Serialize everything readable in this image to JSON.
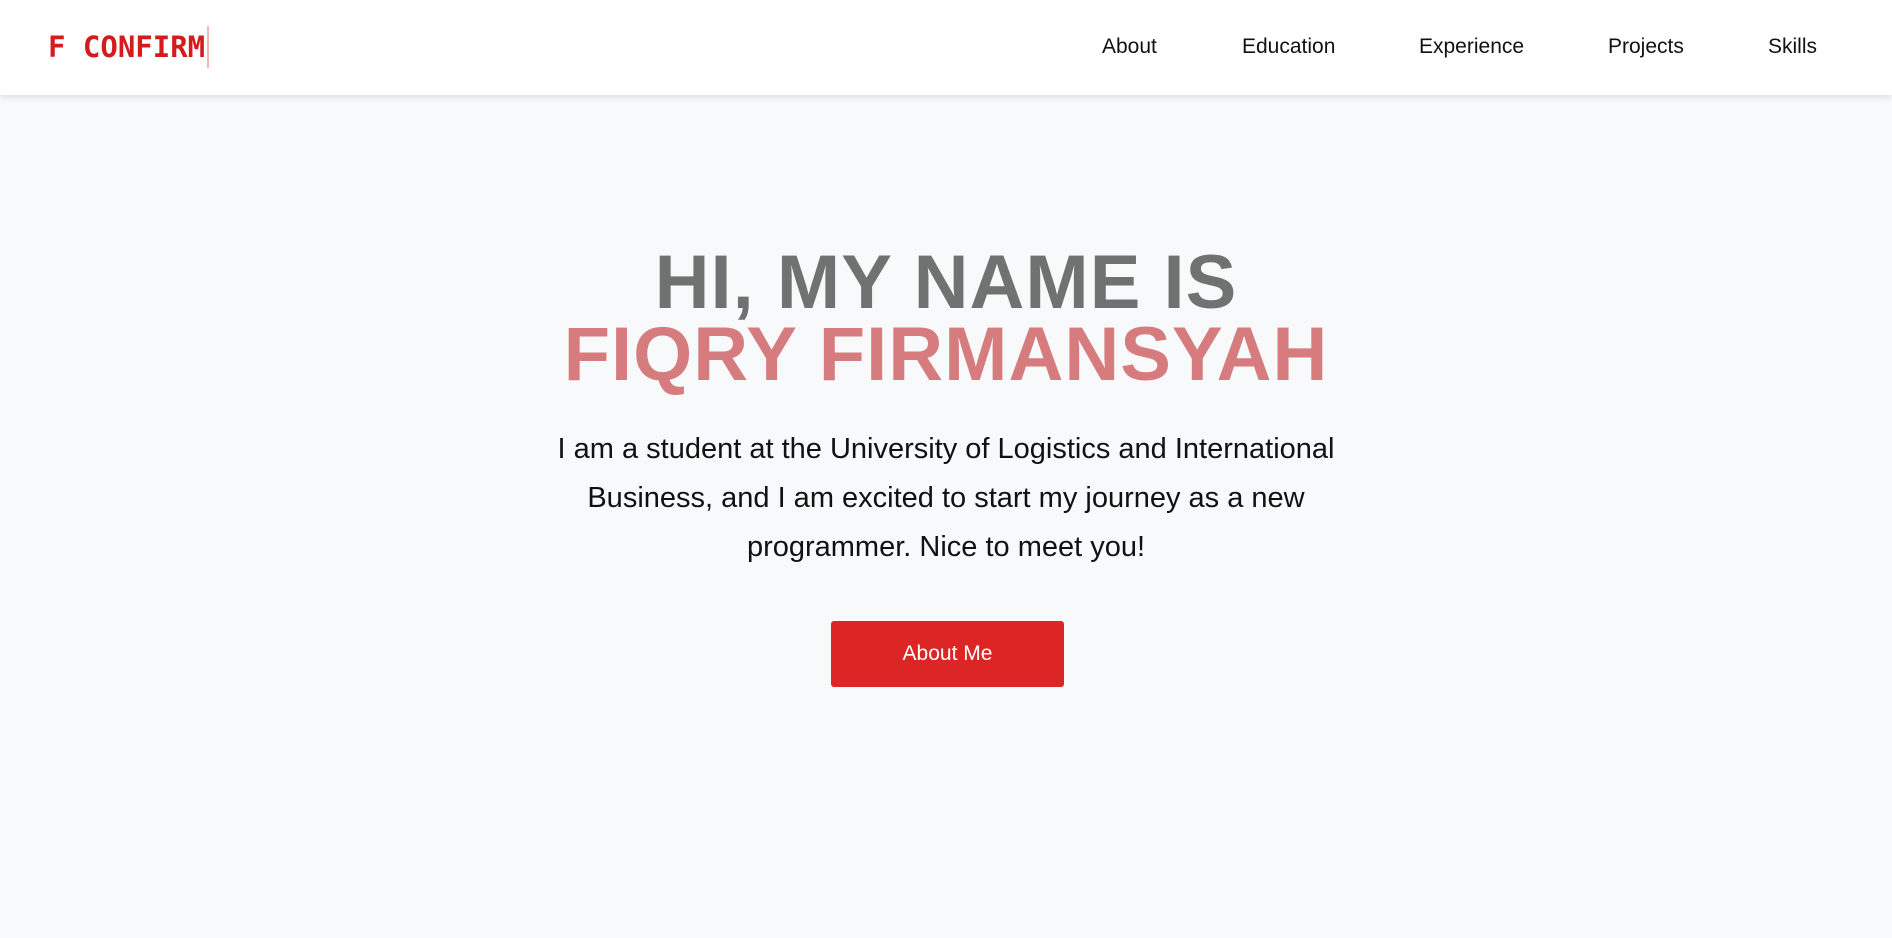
{
  "navbar": {
    "logo": "F CONFIRM",
    "links": [
      {
        "label": "About"
      },
      {
        "label": "Education"
      },
      {
        "label": "Experience"
      },
      {
        "label": "Projects"
      },
      {
        "label": "Skills"
      }
    ]
  },
  "hero": {
    "greeting": "HI, MY NAME IS",
    "name": "FIQRY FIRMANSYAH",
    "intro": "I am a student at the University of Logistics and International Business, and I am excited to start my journey as a new programmer. Nice to meet you!",
    "cta_label": "About Me"
  },
  "colors": {
    "accent": "#dc2626",
    "logo": "#d41c1c",
    "greeting": "#707271",
    "name": "#d67c7e",
    "background": "#f8f9fa"
  }
}
